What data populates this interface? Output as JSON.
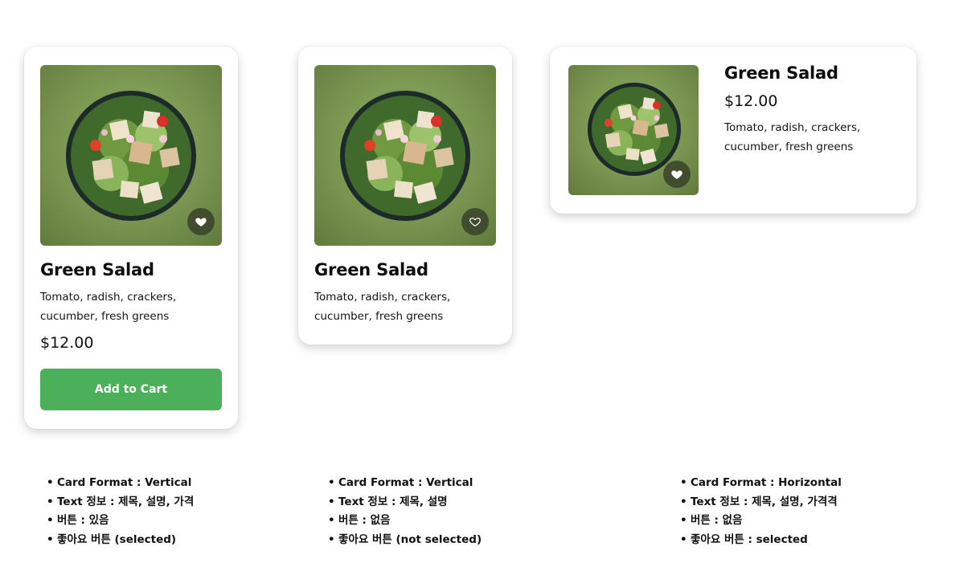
{
  "cards": [
    {
      "format": "vertical",
      "title": "Green Salad",
      "description": "Tomato, radish, crackers, cucumber, fresh greens",
      "price": "$12.00",
      "button_label": "Add to Cart",
      "favorite_selected": true
    },
    {
      "format": "vertical",
      "title": "Green Salad",
      "description": "Tomato, radish, crackers, cucumber, fresh greens",
      "favorite_selected": false
    },
    {
      "format": "horizontal",
      "title": "Green Salad",
      "price": "$12.00",
      "description": "Tomato, radish, crackers, cucumber, fresh greens",
      "favorite_selected": true
    }
  ],
  "notes": [
    [
      "Card Format : Vertical",
      "Text 정보 : 제목, 설명, 가격",
      "버튼 : 있음",
      "좋아요 버튼 (selected)"
    ],
    [
      "Card Format : Vertical",
      "Text 정보 : 제목, 설명",
      "버튼 : 없음",
      "좋아요 버튼  (not selected)"
    ],
    [
      "Card Format : Horizontal",
      "Text 정보 : 제목, 설명, 가격격",
      "버튼 : 없음",
      "좋아요 버튼 : selected"
    ]
  ],
  "colors": {
    "accent_button": "#4caf5a",
    "photo_background": "#7e9b55",
    "heart_button_bg": "#3a422c"
  },
  "icons": {
    "favorite_selected": "heart-filled-icon",
    "favorite_not_selected": "heart-outline-icon"
  }
}
